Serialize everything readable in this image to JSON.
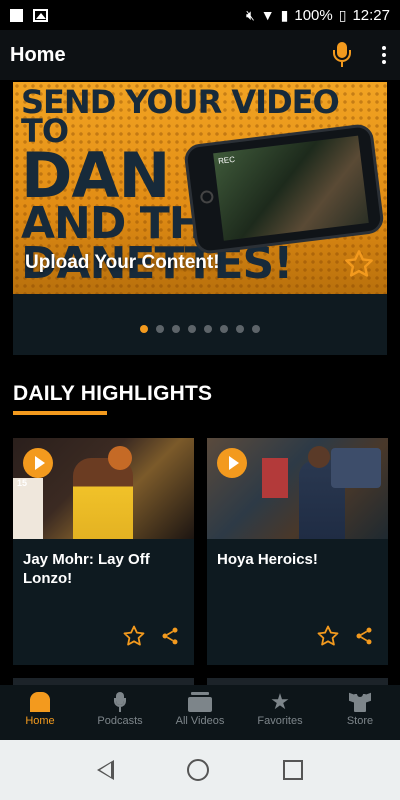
{
  "status_bar": {
    "battery": "100%",
    "time": "12:27"
  },
  "app_bar": {
    "title": "Home"
  },
  "banner": {
    "headline_line1": "SEND YOUR VIDEO TO",
    "headline_line2": "DAN",
    "headline_line3": "AND THE",
    "headline_line4": "DANETTES!",
    "phone_overlay": "REC",
    "caption": "Upload Your Content!",
    "pager_count": 8,
    "pager_active_index": 0
  },
  "section": {
    "title": "DAILY HIGHLIGHTS"
  },
  "cards": [
    {
      "title": "Jay Mohr: Lay Off Lonzo!",
      "thumb_text": "15"
    },
    {
      "title": "Hoya Heroics!"
    }
  ],
  "bottom_nav": {
    "items": [
      {
        "label": "Home",
        "icon": "home-icon",
        "active": true
      },
      {
        "label": "Podcasts",
        "icon": "microphone-icon",
        "active": false
      },
      {
        "label": "All Videos",
        "icon": "videos-icon",
        "active": false
      },
      {
        "label": "Favorites",
        "icon": "star-icon",
        "active": false
      },
      {
        "label": "Store",
        "icon": "shirt-icon",
        "active": false
      }
    ]
  },
  "colors": {
    "accent": "#f39a1e",
    "background": "#000000",
    "card": "#0e1a20",
    "nav_inactive": "#7d858a"
  }
}
